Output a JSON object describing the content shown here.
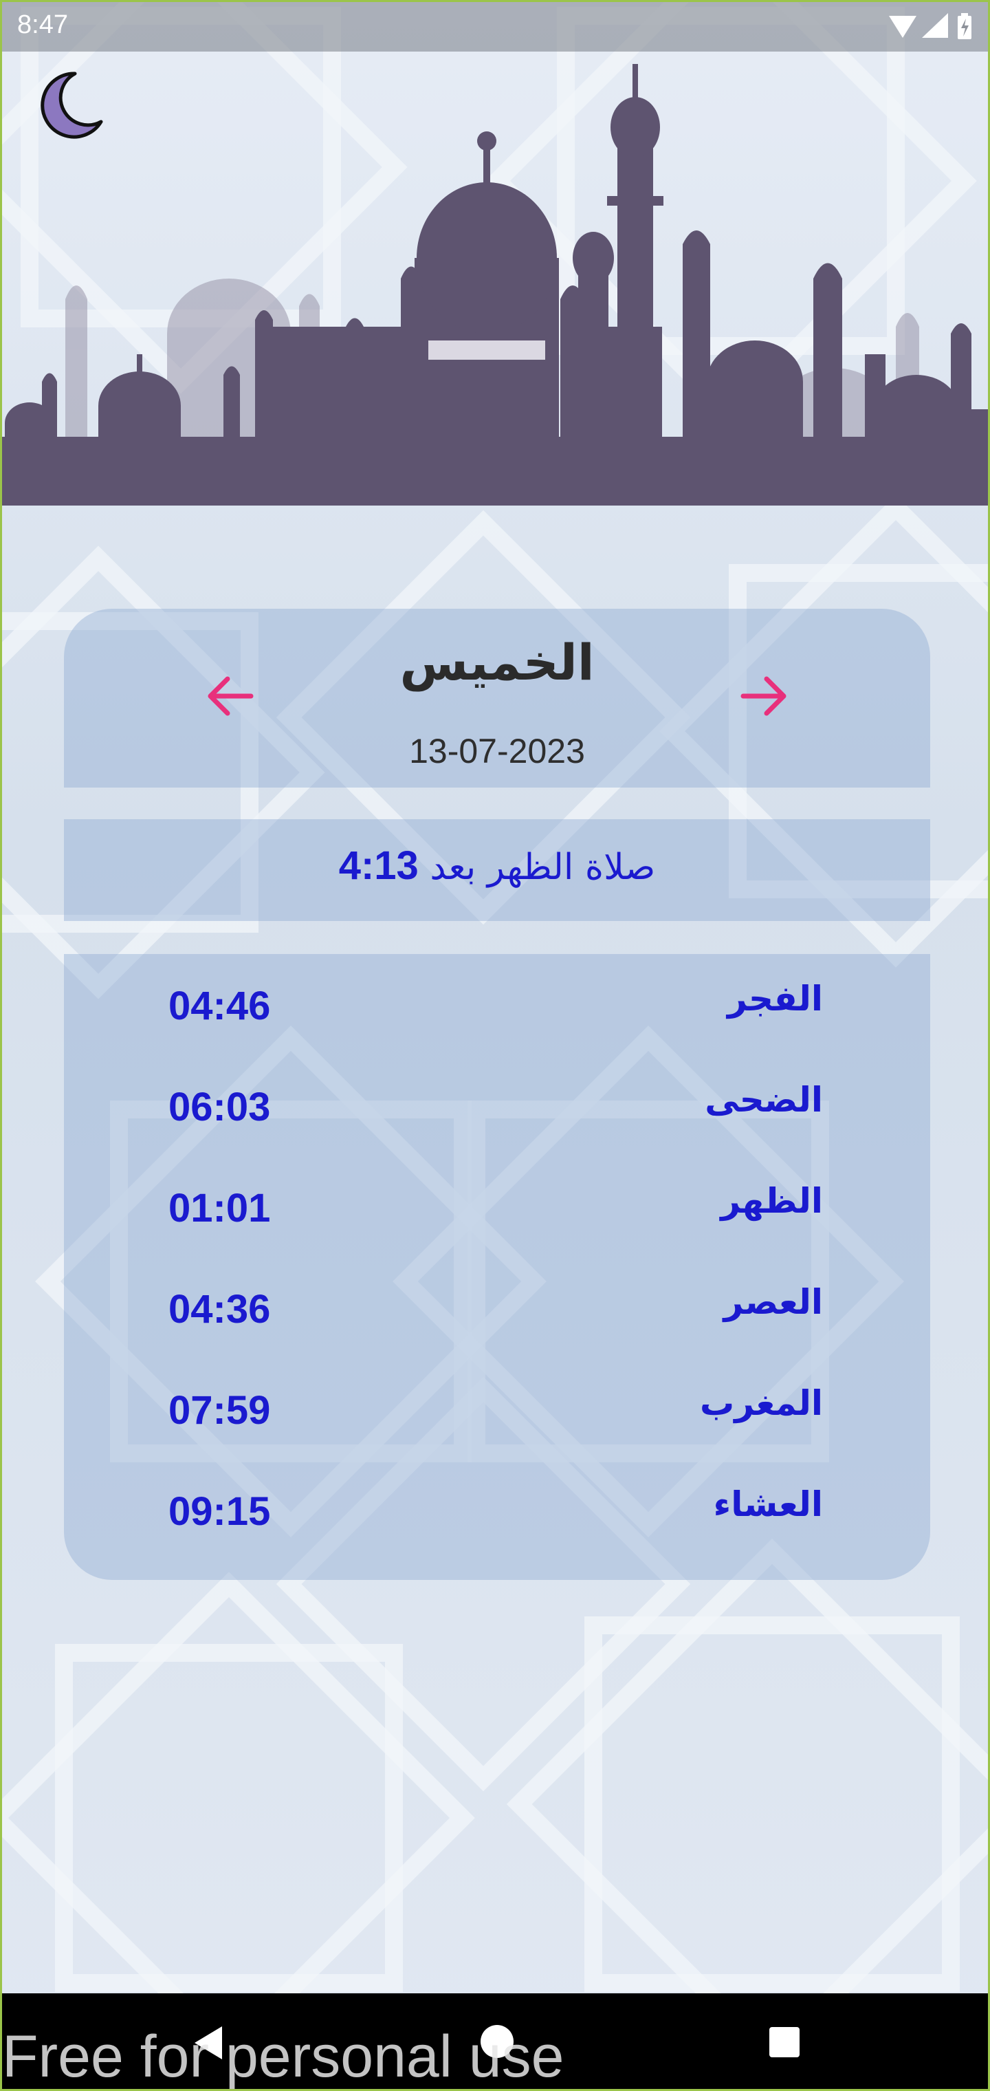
{
  "status_bar": {
    "time": "8:47",
    "icons": [
      "wifi-icon",
      "cellular-signal-icon",
      "battery-charging-icon"
    ]
  },
  "header": {
    "theme_toggle_icon": "crescent-moon-icon",
    "banner": "mosque-skyline-illustration"
  },
  "day_card": {
    "day_name": "الخميس",
    "date": "13-07-2023",
    "prev_icon": "arrow-left-icon",
    "next_icon": "arrow-right-icon"
  },
  "next_prayer": {
    "label": "صلاة الظهر بعد",
    "remaining": "4:13"
  },
  "prayers": [
    {
      "name": "الفجر",
      "time": "04:46"
    },
    {
      "name": "الضحى",
      "time": "06:03"
    },
    {
      "name": "الظهر",
      "time": "01:01"
    },
    {
      "name": "العصر",
      "time": "04:36"
    },
    {
      "name": "المغرب",
      "time": "07:59"
    },
    {
      "name": "العشاء",
      "time": "09:15"
    }
  ],
  "nav_bar": {
    "watermark": "Free for personal use",
    "buttons": [
      "back-icon",
      "home-icon",
      "recents-icon"
    ]
  },
  "colors": {
    "accent_pink": "#e8307c",
    "prayer_text_blue": "#1a1acf",
    "skyline_purple": "#5e5470",
    "moon_purple": "#8c78c0"
  }
}
